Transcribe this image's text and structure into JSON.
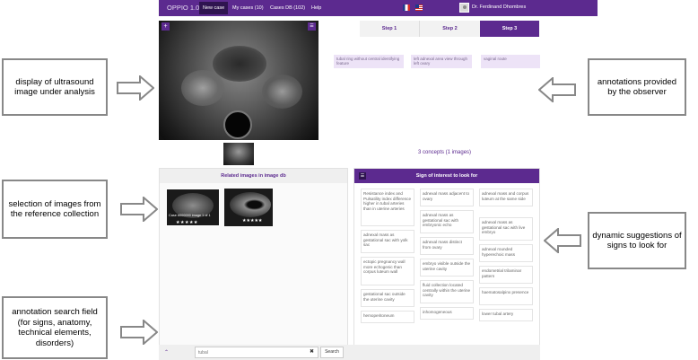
{
  "topbar": {
    "brand": "OPPIO 1.0",
    "nav": [
      "New case",
      "My cases (10)",
      "Cases DB (102)",
      "Help"
    ],
    "user": "Dr. Ferdinand Dhombres"
  },
  "steps": [
    "Step 1",
    "Step 2",
    "Step 3"
  ],
  "annotations": [
    "tubal ring without central identifying feature",
    "left adnexal area view through left ovary",
    "vaginal route"
  ],
  "concepts": "3 concepts (1 images)",
  "related": {
    "title": "Related images in image db",
    "caption": "Case #000000 image 1 of 1"
  },
  "signs": {
    "title": "Sign of interest to look for",
    "items": [
      "Resistance index and Pulsatility index difference higher in tubal arteries than in uterine arteries",
      "adnexal mass adjacent to ovary",
      "adnexal mass and corpus luteum at the same side",
      "adnexal mass as gestational sac with embryonic echo",
      "adnexal mass as gestational sac with live embryo",
      "adnexal mass as gestational sac with yolk sac",
      "adnexal mass distinct from ovary",
      "adnexal rounded hyperechoic mass",
      "ectopic pregnancy wall more echogenic than corpus luteum wall",
      "embryo visible outside the uterine cavity",
      "endometrial trilaminar pattern",
      "gestational sac outside the uterine cavity",
      "fluid collection located centrally within the uterine cavity",
      "haematosalpinx presence",
      "hemoperitoneum",
      "inhomogeneous",
      "lower tubal artery"
    ]
  },
  "search": {
    "value": "tubal",
    "clear": "✖",
    "button": "Search",
    "up": "⌃"
  },
  "callouts": {
    "display": "display of ultrasound image under analysis",
    "annotations": "annotations provided by the observer",
    "selection": "selection of images from the reference collection",
    "dynamic": "dynamic suggestions of signs to look for",
    "search": "annotation search field (for signs, anatomy, technical elements, disorders)"
  },
  "colors": {
    "brand": "#5c2a8f",
    "dark": "#2f1450"
  }
}
